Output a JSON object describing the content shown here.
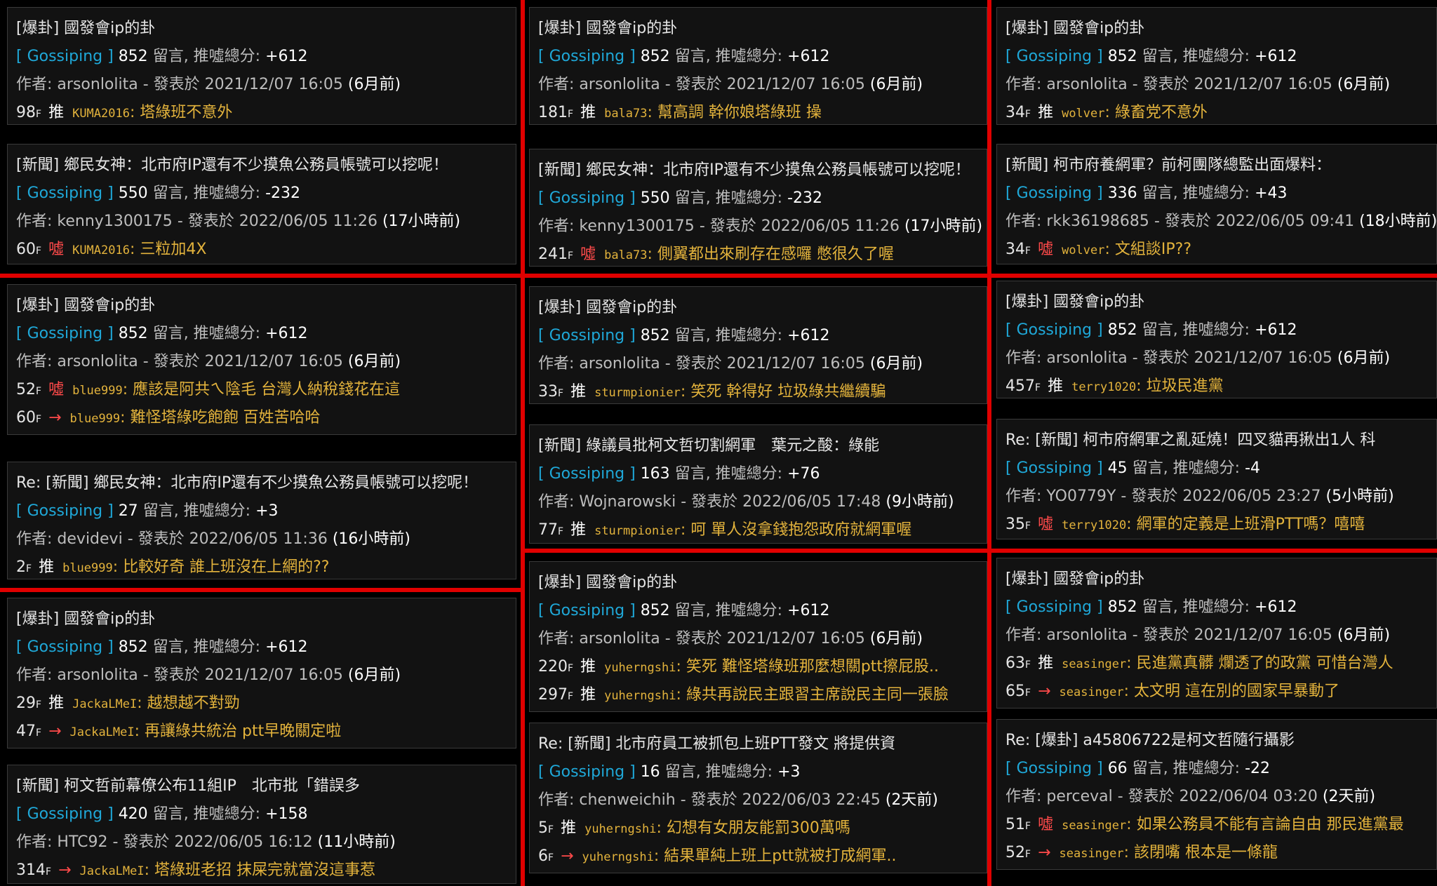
{
  "cards": [
    {
      "title": "[爆卦] 國發會ip的卦",
      "board": "[ Gossiping ]",
      "count": "852",
      "count_suffix": "留言, 推噓總分:",
      "score": "+612",
      "author_label": "作者:",
      "author": "arsonlolita",
      "date_label": "- 發表於",
      "date": "2021/12/07 16:05",
      "ago": "(6月前)",
      "comments": [
        {
          "floor": "98",
          "f": "F",
          "type": "推",
          "user": "KUMA2016",
          "text": "塔綠班不意外"
        }
      ]
    },
    {
      "title": "[新聞] 鄉民女神：北市府IP還有不少摸魚公務員帳號可以挖呢！",
      "board": "[ Gossiping ]",
      "count": "550",
      "count_suffix": "留言, 推噓總分:",
      "score": "-232",
      "author_label": "作者:",
      "author": "kenny1300175",
      "date_label": "- 發表於",
      "date": "2022/06/05 11:26",
      "ago": "(17小時前)",
      "comments": [
        {
          "floor": "60",
          "f": "F",
          "type": "噓",
          "user": "KUMA2016",
          "text": "三粒加4X"
        }
      ]
    },
    {
      "title": "[爆卦] 國發會ip的卦",
      "board": "[ Gossiping ]",
      "count": "852",
      "count_suffix": "留言, 推噓總分:",
      "score": "+612",
      "author_label": "作者:",
      "author": "arsonlolita",
      "date_label": "- 發表於",
      "date": "2021/12/07 16:05",
      "ago": "(6月前)",
      "comments": [
        {
          "floor": "52",
          "f": "F",
          "type": "噓",
          "user": "blue999",
          "text": "應該是阿共ㄟ陰毛 台灣人納稅錢花在這"
        },
        {
          "floor": "60",
          "f": "F",
          "type": "→",
          "user": "blue999",
          "text": "難怪塔綠吃飽飽 百姓苦哈哈"
        }
      ]
    },
    {
      "title": "Re: [新聞] 鄉民女神：北市府IP還有不少摸魚公務員帳號可以挖呢！",
      "board": "[ Gossiping ]",
      "count": "27",
      "count_suffix": "留言, 推噓總分:",
      "score": "+3",
      "author_label": "作者:",
      "author": "devidevi",
      "date_label": "- 發表於",
      "date": "2022/06/05 11:36",
      "ago": "(16小時前)",
      "comments": [
        {
          "floor": "2",
          "f": "F",
          "type": "推",
          "user": "blue999",
          "text": "比較好奇 誰上班沒在上網的??"
        }
      ]
    },
    {
      "title": "[爆卦] 國發會ip的卦",
      "board": "[ Gossiping ]",
      "count": "852",
      "count_suffix": "留言, 推噓總分:",
      "score": "+612",
      "author_label": "作者:",
      "author": "arsonlolita",
      "date_label": "- 發表於",
      "date": "2021/12/07 16:05",
      "ago": "(6月前)",
      "comments": [
        {
          "floor": "29",
          "f": "F",
          "type": "推",
          "user": "JackaLMeI",
          "text": "越想越不對勁"
        },
        {
          "floor": "47",
          "f": "F",
          "type": "→",
          "user": "JackaLMeI",
          "text": "再讓綠共統治 ptt早晚關定啦"
        }
      ]
    },
    {
      "title": "[新聞] 柯文哲前幕僚公布11組IP　北市批「錯誤多",
      "board": "[ Gossiping ]",
      "count": "420",
      "count_suffix": "留言, 推噓總分:",
      "score": "+158",
      "author_label": "作者:",
      "author": "HTC92",
      "date_label": "- 發表於",
      "date": "2022/06/05 16:12",
      "ago": "(11小時前)",
      "comments": [
        {
          "floor": "314",
          "f": "F",
          "type": "→",
          "user": "JackaLMeI",
          "text": "塔綠班老招 抹屎完就當沒這事惹"
        }
      ]
    },
    {
      "title": "[爆卦] 國發會ip的卦",
      "board": "[ Gossiping ]",
      "count": "852",
      "count_suffix": "留言, 推噓總分:",
      "score": "+612",
      "author_label": "作者:",
      "author": "arsonlolita",
      "date_label": "- 發表於",
      "date": "2021/12/07 16:05",
      "ago": "(6月前)",
      "comments": [
        {
          "floor": "181",
          "f": "F",
          "type": "推",
          "user": "bala73",
          "text": "幫高調 幹你娘塔綠班 操"
        }
      ]
    },
    {
      "title": "[新聞] 鄉民女神：北市府IP還有不少摸魚公務員帳號可以挖呢！",
      "board": "[ Gossiping ]",
      "count": "550",
      "count_suffix": "留言, 推噓總分:",
      "score": "-232",
      "author_label": "作者:",
      "author": "kenny1300175",
      "date_label": "- 發表於",
      "date": "2022/06/05 11:26",
      "ago": "(17小時前)",
      "comments": [
        {
          "floor": "241",
          "f": "F",
          "type": "噓",
          "user": "bala73",
          "text": "側翼都出來刷存在感囉 憋很久了喔"
        }
      ]
    },
    {
      "title": "[爆卦] 國發會ip的卦",
      "board": "[ Gossiping ]",
      "count": "852",
      "count_suffix": "留言, 推噓總分:",
      "score": "+612",
      "author_label": "作者:",
      "author": "arsonlolita",
      "date_label": "- 發表於",
      "date": "2021/12/07 16:05",
      "ago": "(6月前)",
      "comments": [
        {
          "floor": "33",
          "f": "F",
          "type": "推",
          "user": "sturmpionier",
          "text": "笑死 幹得好 垃圾綠共繼續騙"
        }
      ]
    },
    {
      "title": "[新聞] 綠議員批柯文哲切割網軍　葉元之酸：綠能",
      "board": "[ Gossiping ]",
      "count": "163",
      "count_suffix": "留言, 推噓總分:",
      "score": "+76",
      "author_label": "作者:",
      "author": "Wojnarowski",
      "date_label": "- 發表於",
      "date": "2022/06/05 17:48",
      "ago": "(9小時前)",
      "comments": [
        {
          "floor": "77",
          "f": "F",
          "type": "推",
          "user": "sturmpionier",
          "text": "呵 單人沒拿錢抱怨政府就網軍喔"
        }
      ]
    },
    {
      "title": "[爆卦] 國發會ip的卦",
      "board": "[ Gossiping ]",
      "count": "852",
      "count_suffix": "留言, 推噓總分:",
      "score": "+612",
      "author_label": "作者:",
      "author": "arsonlolita",
      "date_label": "- 發表於",
      "date": "2021/12/07 16:05",
      "ago": "(6月前)",
      "comments": [
        {
          "floor": "220",
          "f": "F",
          "type": "推",
          "user": "yuherngshi",
          "text": "笑死 難怪塔綠班那麼想關ptt擦屁股.."
        },
        {
          "floor": "297",
          "f": "F",
          "type": "推",
          "user": "yuherngshi",
          "text": "綠共再說民主跟習主席說民主同一張臉"
        }
      ]
    },
    {
      "title": "Re: [新聞] 北市府員工被抓包上班PTT發文 將提供資",
      "board": "[ Gossiping ]",
      "count": "16",
      "count_suffix": "留言, 推噓總分:",
      "score": "+3",
      "author_label": "作者:",
      "author": "chenweichih",
      "date_label": "- 發表於",
      "date": "2022/06/03 22:45",
      "ago": "(2天前)",
      "comments": [
        {
          "floor": "5",
          "f": "F",
          "type": "推",
          "user": "yuherngshi",
          "text": "幻想有女朋友能罰300萬嗎"
        },
        {
          "floor": "6",
          "f": "F",
          "type": "→",
          "user": "yuherngshi",
          "text": "結果單純上班上ptt就被打成網軍.."
        }
      ]
    },
    {
      "title": "[爆卦] 國發會ip的卦",
      "board": "[ Gossiping ]",
      "count": "852",
      "count_suffix": "留言, 推噓總分:",
      "score": "+612",
      "author_label": "作者:",
      "author": "arsonlolita",
      "date_label": "- 發表於",
      "date": "2021/12/07 16:05",
      "ago": "(6月前)",
      "comments": [
        {
          "floor": "34",
          "f": "F",
          "type": "推",
          "user": "wolver",
          "text": "綠畜党不意外"
        }
      ]
    },
    {
      "title": "[新聞] 柯市府養網軍？前柯團隊總監出面爆料：",
      "board": "[ Gossiping ]",
      "count": "336",
      "count_suffix": "留言, 推噓總分:",
      "score": "+43",
      "author_label": "作者:",
      "author": "rkk36198685",
      "date_label": "- 發表於",
      "date": "2022/06/05 09:41",
      "ago": "(18小時前)",
      "comments": [
        {
          "floor": "34",
          "f": "F",
          "type": "噓",
          "user": "wolver",
          "text": "文組談IP??"
        }
      ]
    },
    {
      "title": "[爆卦] 國發會ip的卦",
      "board": "[ Gossiping ]",
      "count": "852",
      "count_suffix": "留言, 推噓總分:",
      "score": "+612",
      "author_label": "作者:",
      "author": "arsonlolita",
      "date_label": "- 發表於",
      "date": "2021/12/07 16:05",
      "ago": "(6月前)",
      "comments": [
        {
          "floor": "457",
          "f": "F",
          "type": "推",
          "user": "terry1020",
          "text": "垃圾民進黨"
        }
      ]
    },
    {
      "title": "Re: [新聞] 柯市府網軍之亂延燒！四叉貓再揪出1人 科",
      "board": "[ Gossiping ]",
      "count": "45",
      "count_suffix": "留言, 推噓總分:",
      "score": "-4",
      "author_label": "作者:",
      "author": "YO0779Y",
      "date_label": "- 發表於",
      "date": "2022/06/05 23:27",
      "ago": "(5小時前)",
      "comments": [
        {
          "floor": "35",
          "f": "F",
          "type": "噓",
          "user": "terry1020",
          "text": "網軍的定義是上班滑PTT嗎？嘻嘻"
        }
      ]
    },
    {
      "title": "[爆卦] 國發會ip的卦",
      "board": "[ Gossiping ]",
      "count": "852",
      "count_suffix": "留言, 推噓總分:",
      "score": "+612",
      "author_label": "作者:",
      "author": "arsonlolita",
      "date_label": "- 發表於",
      "date": "2021/12/07 16:05",
      "ago": "(6月前)",
      "comments": [
        {
          "floor": "63",
          "f": "F",
          "type": "推",
          "user": "seasinger",
          "text": "民進黨真髒 爛透了的政黨 可惜台灣人"
        },
        {
          "floor": "65",
          "f": "F",
          "type": "→",
          "user": "seasinger",
          "text": "太文明 這在別的國家早暴動了"
        }
      ]
    },
    {
      "title": "Re: [爆卦] a45806722是柯文哲隨行攝影",
      "board": "[ Gossiping ]",
      "count": "66",
      "count_suffix": "留言, 推噓總分:",
      "score": "-22",
      "author_label": "作者:",
      "author": "perceval",
      "date_label": "- 發表於",
      "date": "2022/06/04 03:20",
      "ago": "(2天前)",
      "comments": [
        {
          "floor": "51",
          "f": "F",
          "type": "噓",
          "user": "seasinger",
          "text": "如果公務員不能有言論自由 那民進黨最"
        },
        {
          "floor": "52",
          "f": "F",
          "type": "→",
          "user": "seasinger",
          "text": "該閉嘴 根本是一條龍"
        }
      ]
    }
  ]
}
